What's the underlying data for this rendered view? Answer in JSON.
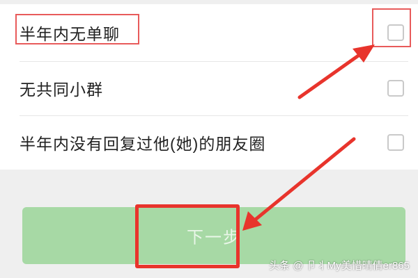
{
  "options": [
    {
      "label": "半年内无单聊",
      "checked": false
    },
    {
      "label": "无共同小群",
      "checked": false
    },
    {
      "label": "半年内没有回复过他(她)的朋友圈",
      "checked": false
    }
  ],
  "next_button": {
    "label": "下一步",
    "enabled": false
  },
  "watermark": "头条 @ 卩丬My美惜晴倩er865",
  "colors": {
    "annotation": "#e8342c",
    "button": "#a7d9a5"
  }
}
